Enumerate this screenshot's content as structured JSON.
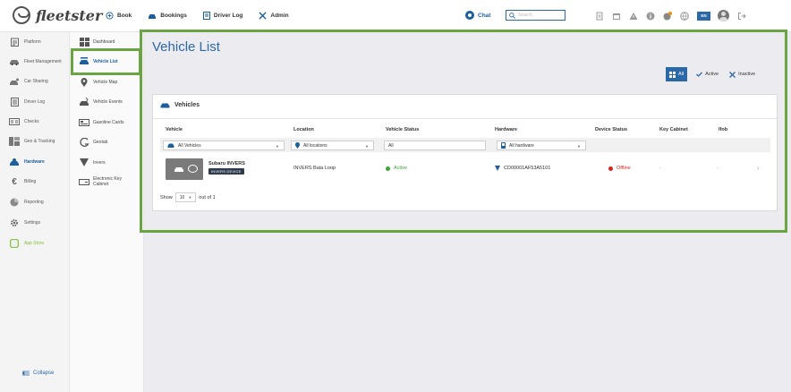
{
  "app": {
    "brand": "fleetster",
    "colors": {
      "accent": "#2b68a8",
      "highlight": "#6aa544",
      "active_status": "#3fa535",
      "offline_status": "#d7261e",
      "app_store": "#7dc23a"
    }
  },
  "topnav": {
    "items": [
      {
        "label": "Book",
        "icon": "plus-circle-icon"
      },
      {
        "label": "Bookings",
        "icon": "car-icon"
      },
      {
        "label": "Driver Log",
        "icon": "logbook-icon"
      },
      {
        "label": "Admin",
        "icon": "tools-icon"
      }
    ],
    "chat_label": "Chat",
    "search_placeholder": "Search",
    "language": "EN"
  },
  "sidebar_main": {
    "items": [
      {
        "label": "Platform",
        "icon": "clipboard-icon"
      },
      {
        "label": "Fleet Management",
        "icon": "car-icon"
      },
      {
        "label": "Car Sharing",
        "icon": "car-sharing-icon"
      },
      {
        "label": "Driver Log",
        "icon": "logbook-icon"
      },
      {
        "label": "Checks",
        "icon": "checks-icon"
      },
      {
        "label": "Geo & Tracking",
        "icon": "map-icon"
      },
      {
        "label": "Hardware",
        "icon": "hardware-icon"
      },
      {
        "label": "Billing",
        "icon": "euro-icon"
      },
      {
        "label": "Reporting",
        "icon": "pie-chart-icon"
      },
      {
        "label": "Settings",
        "icon": "gear-icon"
      },
      {
        "label": "App Store",
        "icon": "app-store-icon"
      }
    ],
    "active_index": 6,
    "collapse_label": "Collapse"
  },
  "sidebar_sub": {
    "items": [
      {
        "label": "Dashboard",
        "icon": "dashboard-icon"
      },
      {
        "label": "Vehicle List",
        "icon": "vehicle-list-icon"
      },
      {
        "label": "Vehicle Map",
        "icon": "map-pin-icon"
      },
      {
        "label": "Vehicle Events",
        "icon": "vehicle-events-icon"
      },
      {
        "label": "Gasoline Cards",
        "icon": "card-icon"
      },
      {
        "label": "Geotab",
        "icon": "geotab-icon"
      },
      {
        "label": "Invers",
        "icon": "invers-icon"
      },
      {
        "label": "Electronic Key",
        "label2": "Cabinet",
        "icon": "key-cabinet-icon"
      }
    ],
    "active_index": 1
  },
  "main": {
    "title": "Vehicle List",
    "filters": {
      "all": "All",
      "active": "Active",
      "inactive": "Inactive"
    },
    "card_title": "Vehicles",
    "columns": [
      "Vehicle",
      "Location",
      "Vehicle Status",
      "Hardware",
      "Device Status",
      "Key Cabinet",
      "Ifob"
    ],
    "column_filters": {
      "vehicle": "All Vehicles",
      "location": "All locations",
      "status": "All",
      "hardware": "All hardware"
    },
    "rows": [
      {
        "vehicle": "Subaru INVERS",
        "badge": "INVERS DEVICE",
        "location": "INVERS Bata Loop",
        "vehicle_status": "Active",
        "hardware": "CD00001AF53A5101",
        "device_status": "Offline",
        "key_cabinet": "-",
        "ifob": "-"
      }
    ],
    "pager": {
      "show_label": "Show",
      "page_size": "10",
      "out_of": "out of 1"
    }
  }
}
